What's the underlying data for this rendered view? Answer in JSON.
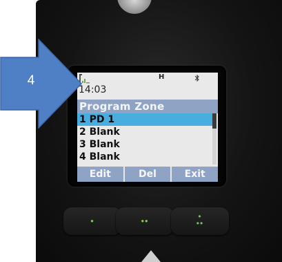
{
  "callout": {
    "number": "4",
    "color": "#4f7fc4"
  },
  "status_bar": {
    "signal_icon": "signal-strength-icon",
    "mode_indicator": "H",
    "bluetooth_icon": "bluetooth-icon",
    "time": "14:03"
  },
  "screen": {
    "title": "Program Zone",
    "items": [
      {
        "label": "1 PD 1",
        "selected": true
      },
      {
        "label": "2 Blank",
        "selected": false
      },
      {
        "label": "3 Blank",
        "selected": false
      },
      {
        "label": "4 Blank",
        "selected": false
      }
    ],
    "softkeys": [
      {
        "label": "Edit"
      },
      {
        "label": "Del"
      },
      {
        "label": "Exit"
      }
    ]
  },
  "colors": {
    "title_bar": "#8fa3c4",
    "selection": "#48aee0",
    "lcd_background": "#e9e9ea",
    "key_led": "#7cc35a"
  }
}
